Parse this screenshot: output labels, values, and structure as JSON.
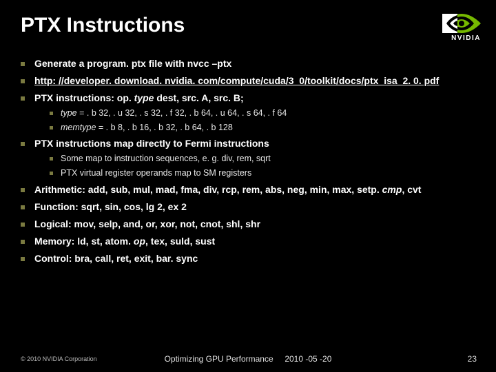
{
  "title": "PTX Instructions",
  "logo": {
    "text": "NVIDIA"
  },
  "bullets": [
    {
      "text": "Generate a program. ptx file with  nvcc –ptx"
    },
    {
      "link": "http: //developer. download. nvidia. com/compute/cuda/3_0/toolkit/docs/ptx_isa_2. 0. pdf"
    },
    {
      "html": "PTX instructions:  op. <i>type</i> dest, src. A, src. B;",
      "sub": [
        {
          "html": "<i>type</i> = . b 32, . u 32, . s 32, . f 32, . b 64, . u 64, . s 64, . f 64"
        },
        {
          "html": "<i>memtype</i> = . b 8, . b 16, . b 32, . b 64, . b 128"
        }
      ]
    },
    {
      "text": "PTX instructions map directly to Fermi instructions",
      "sub": [
        {
          "text": "Some map to instruction sequences, e. g. div, rem, sqrt"
        },
        {
          "text": "PTX virtual register operands map to SM registers"
        }
      ]
    },
    {
      "html": "Arithmetic: add, sub, mul, mad, fma, div, rcp, rem, abs, neg, min, max, setp. <i>cmp</i>, cvt"
    },
    {
      "text": "Function: sqrt, sin, cos, lg 2, ex 2"
    },
    {
      "text": "Logical: mov, selp, and, or, xor, not, cnot, shl, shr"
    },
    {
      "html": "Memory: ld, st, atom. <i>op</i>, tex, suld, sust"
    },
    {
      "text": "Control: bra, call, ret, exit, bar. sync"
    }
  ],
  "footer": {
    "left": "© 2010 NVIDIA Corporation",
    "center_title": "Optimizing GPU Performance",
    "center_date": "2010 -05 -20",
    "right": "23"
  }
}
